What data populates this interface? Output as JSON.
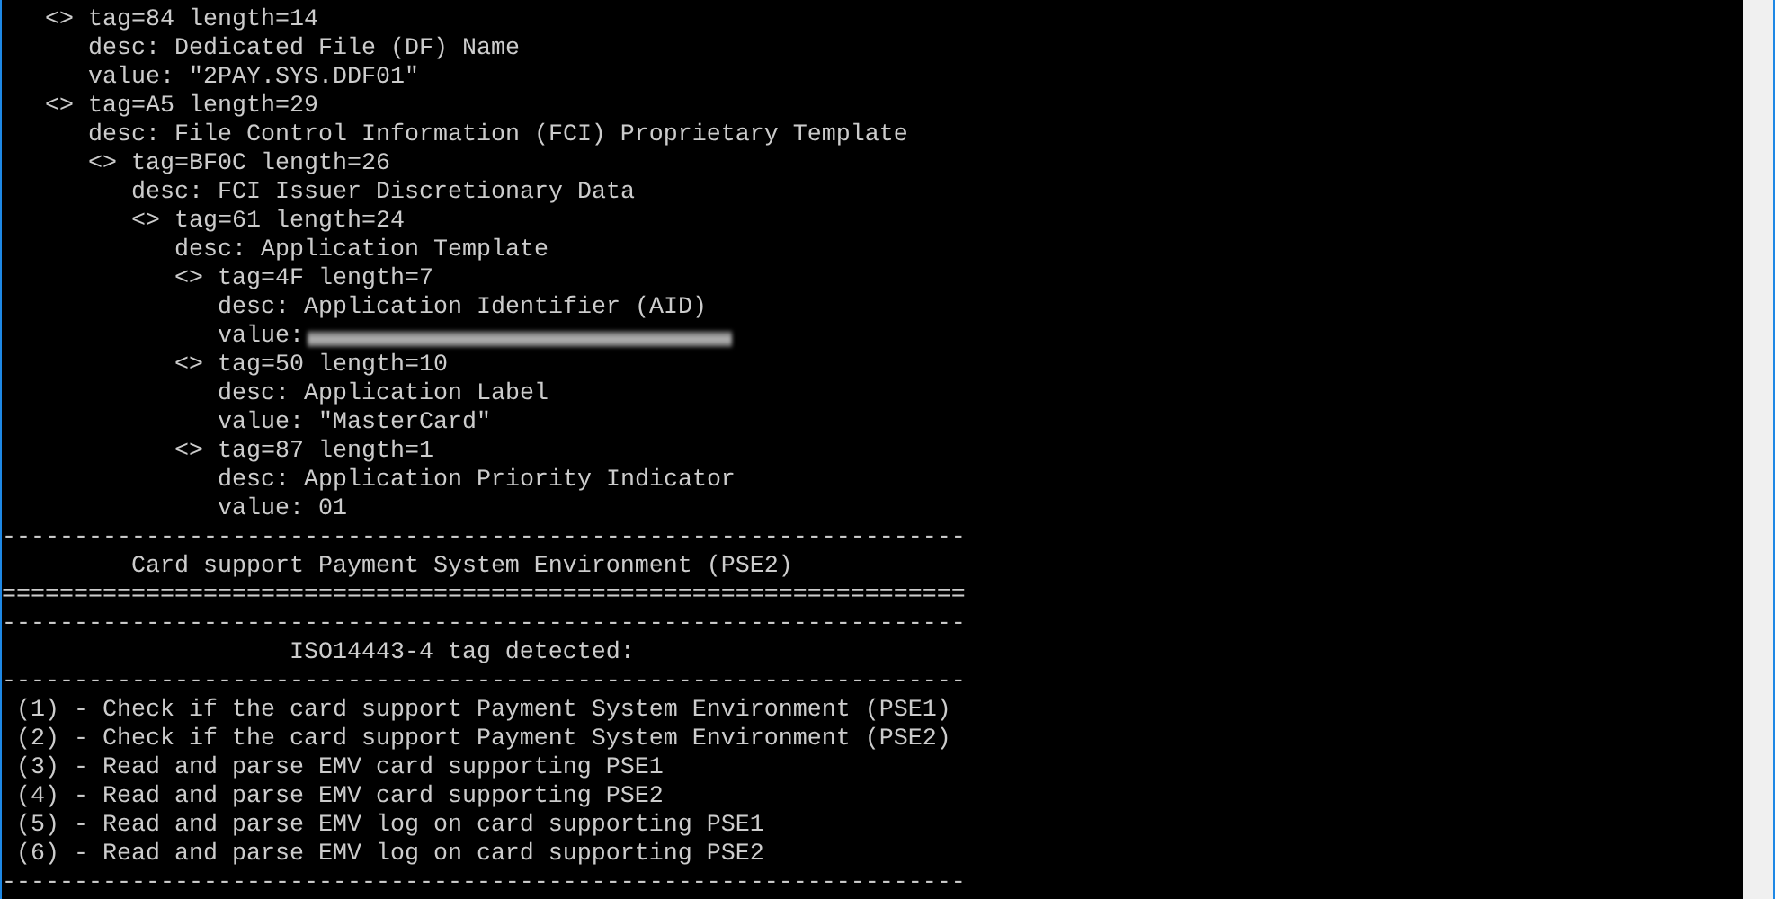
{
  "tlv": [
    {
      "header": "<> tag=84 length=14",
      "fields": [
        "desc: Dedicated File (DF) Name",
        "value: \"2PAY.SYS.DDF01\""
      ]
    },
    {
      "header": "<> tag=A5 length=29",
      "fields": [
        "desc: File Control Information (FCI) Proprietary Template"
      ],
      "children": [
        {
          "header": "<> tag=BF0C length=26",
          "fields": [
            "desc: FCI Issuer Discretionary Data"
          ],
          "children": [
            {
              "header": "<> tag=61 length=24",
              "fields": [
                "desc: Application Template"
              ],
              "children": [
                {
                  "header": "<> tag=4F length=7",
                  "fields": [
                    "desc: Application Identifier (AID)"
                  ],
                  "blurred_value_label": "value:"
                },
                {
                  "header": "<> tag=50 length=10",
                  "fields": [
                    "desc: Application Label",
                    "value: \"MasterCard\""
                  ]
                },
                {
                  "header": "<> tag=87 length=1",
                  "fields": [
                    "desc: Application Priority Indicator",
                    "value: 01"
                  ]
                }
              ]
            }
          ]
        }
      ]
    }
  ],
  "output": [
    "-------------------------------------------------------------------",
    "         Card support Payment System Environment (PSE2)",
    "===================================================================",
    "-------------------------------------------------------------------",
    "                    ISO14443-4 tag detected:",
    "-------------------------------------------------------------------",
    " (1) - Check if the card support Payment System Environment (PSE1)",
    " (2) - Check if the card support Payment System Environment (PSE2)",
    " (3) - Read and parse EMV card supporting PSE1",
    " (4) - Read and parse EMV card supporting PSE2",
    " (5) - Read and parse EMV log on card supporting PSE1",
    " (6) - Read and parse EMV log on card supporting PSE2",
    "-------------------------------------------------------------------"
  ]
}
